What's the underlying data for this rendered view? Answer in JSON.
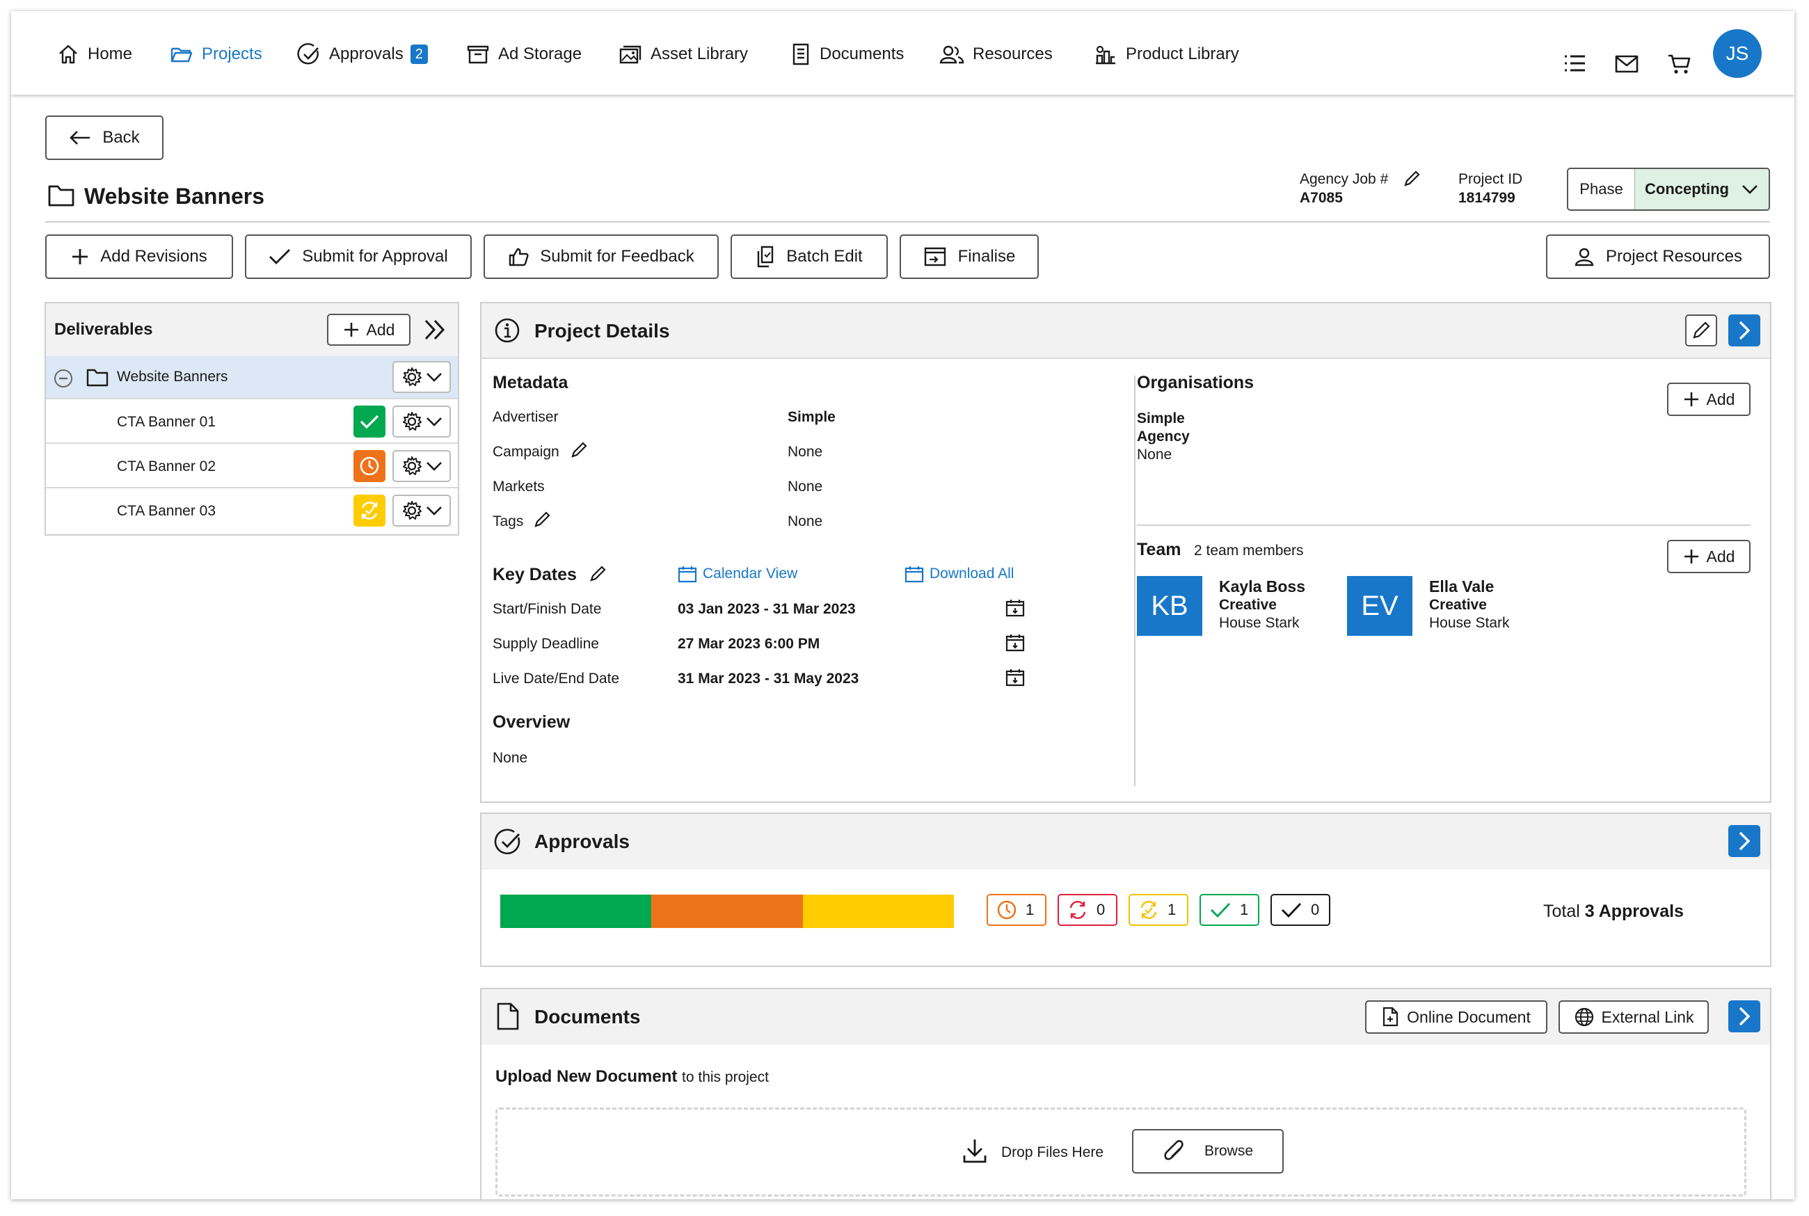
{
  "nav": {
    "items": [
      {
        "label": "Home"
      },
      {
        "label": "Projects"
      },
      {
        "label": "Approvals",
        "badge": "2"
      },
      {
        "label": "Ad Storage"
      },
      {
        "label": "Asset Library"
      },
      {
        "label": "Documents"
      },
      {
        "label": "Resources"
      },
      {
        "label": "Product Library"
      }
    ],
    "active": "Projects",
    "user_initials": "JS"
  },
  "header": {
    "back_label": "Back",
    "title": "Website Banners",
    "agency_job_label": "Agency Job #",
    "agency_job_value": "A7085",
    "project_id_label": "Project ID",
    "project_id_value": "1814799",
    "phase_label": "Phase",
    "phase_value": "Concepting"
  },
  "toolbar": {
    "add_revisions": "Add Revisions",
    "submit_approval": "Submit for Approval",
    "submit_feedback": "Submit for Feedback",
    "batch_edit": "Batch Edit",
    "finalise": "Finalise",
    "project_resources": "Project Resources"
  },
  "deliverables": {
    "title": "Deliverables",
    "add_label": "Add",
    "root": "Website Banners",
    "items": [
      {
        "label": "CTA Banner 01",
        "status": "approved"
      },
      {
        "label": "CTA Banner 02",
        "status": "pending"
      },
      {
        "label": "CTA Banner 03",
        "status": "in-progress"
      }
    ]
  },
  "project_details": {
    "title": "Project Details",
    "metadata": {
      "heading": "Metadata",
      "rows": [
        {
          "label": "Advertiser",
          "value": "Simple"
        },
        {
          "label": "Campaign",
          "value": "None"
        },
        {
          "label": "Markets",
          "value": "None"
        },
        {
          "label": "Tags",
          "value": "None"
        }
      ]
    },
    "key_dates": {
      "heading": "Key Dates",
      "calendar_view": "Calendar View",
      "download_all": "Download All",
      "rows": [
        {
          "label": "Start/Finish Date",
          "value": "03 Jan 2023 - 31 Mar 2023"
        },
        {
          "label": "Supply Deadline",
          "value": "27 Mar 2023 6:00 PM"
        },
        {
          "label": "Live Date/End Date",
          "value": "31 Mar 2023 - 31 May 2023"
        }
      ]
    },
    "overview": {
      "heading": "Overview",
      "value": "None"
    },
    "organisations": {
      "heading": "Organisations",
      "add_label": "Add",
      "name": "Simple",
      "type": "Agency",
      "detail": "None"
    },
    "team": {
      "heading": "Team",
      "count": "2 team members",
      "add_label": "Add",
      "members": [
        {
          "initials": "KB",
          "name": "Kayla Boss",
          "role": "Creative",
          "org": "House Stark"
        },
        {
          "initials": "EV",
          "name": "Ella Vale",
          "role": "Creative",
          "org": "House Stark"
        }
      ]
    }
  },
  "approvals": {
    "title": "Approvals",
    "progress": [
      {
        "status": "approved",
        "fraction": 0.3333,
        "color": "#00a84f"
      },
      {
        "status": "pending",
        "fraction": 0.3333,
        "color": "#ee7219"
      },
      {
        "status": "in-progress",
        "fraction": 0.3334,
        "color": "#ffcc00"
      }
    ],
    "counts": [
      {
        "icon": "clock-icon",
        "value": "1",
        "color": "#ee7219"
      },
      {
        "icon": "refresh-icon",
        "value": "0",
        "color": "#e0203a"
      },
      {
        "icon": "progress-icon",
        "value": "1",
        "color": "#f2c200"
      },
      {
        "icon": "check-icon",
        "value": "1",
        "color": "#00a84f"
      },
      {
        "icon": "check-icon",
        "value": "0",
        "color": "#1a1a1a"
      }
    ],
    "total_prefix": "Total",
    "total_value": "3 Approvals"
  },
  "documents": {
    "title": "Documents",
    "online_document": "Online Document",
    "external_link": "External Link",
    "upload_heading": "Upload New Document",
    "upload_suffix": "to this project",
    "drop_label": "Drop Files Here",
    "browse_label": "Browse"
  },
  "colors": {
    "accent": "#1877c8",
    "approved": "#00a84f",
    "pending": "#ee7219",
    "in_progress": "#ffcc00",
    "rejected": "#e0203a",
    "phase_bg": "#dff0e4"
  }
}
